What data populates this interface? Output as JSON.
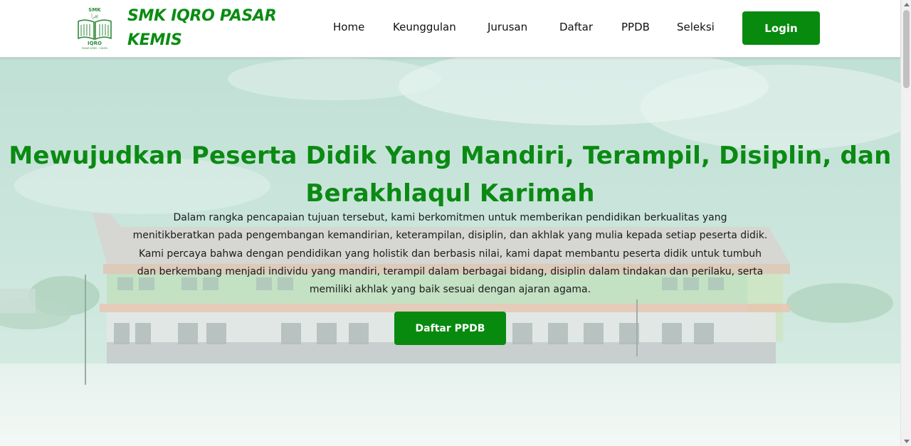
{
  "brand": {
    "name": "SMK IQRO PASAR KEMIS",
    "logo": {
      "top_text": "SMK",
      "bottom_text": "IQRO",
      "caption": "PASAR KEMIS - CIKUPA",
      "color": "#2f8a3a"
    }
  },
  "nav": {
    "items": [
      {
        "label": "Home"
      },
      {
        "label": "Keunggulan"
      },
      {
        "label": "Jurusan"
      },
      {
        "label": "Daftar"
      },
      {
        "label": "PPDB"
      },
      {
        "label": "Seleksi"
      }
    ],
    "login_label": "Login"
  },
  "hero": {
    "title": "Mewujudkan Peserta Didik Yang Mandiri, Terampil, Disiplin, dan Berakhlaqul Karimah",
    "description": "Dalam rangka pencapaian tujuan tersebut, kami berkomitmen untuk memberikan pendidikan berkualitas yang menitikberatkan pada pengembangan kemandirian, keterampilan, disiplin, dan akhlak yang mulia kepada setiap peserta didik. Kami percaya bahwa dengan pendidikan yang holistik dan berbasis nilai, kami dapat membantu peserta didik untuk tumbuh dan berkembang menjadi individu yang mandiri, terampil dalam berbagai bidang, disiplin dalam tindakan dan perilaku, serta memiliki akhlak yang baik sesuai dengan ajaran agama.",
    "cta_label": "Daftar PPDB"
  },
  "colors": {
    "accent": "#078a0e",
    "title": "#0b8a13",
    "overlay": "#e8f5ee"
  }
}
